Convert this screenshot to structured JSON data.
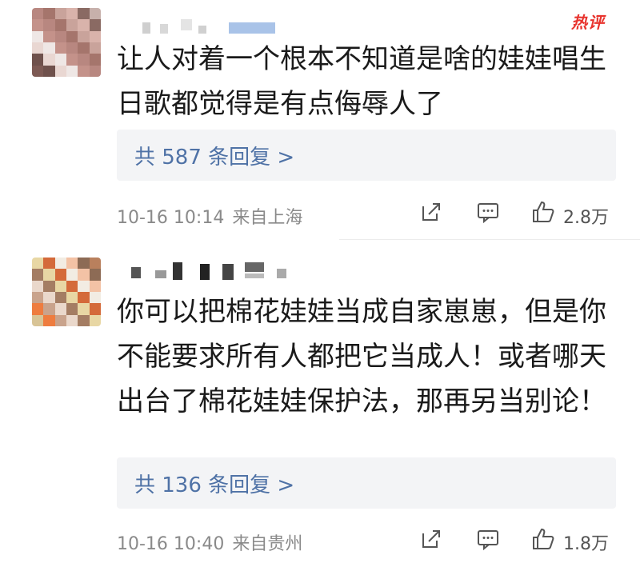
{
  "comments": [
    {
      "hot_badge": "热评",
      "text": "让人对着一个根本不知道是啥的娃娃唱生日歌都觉得是有点侮辱人了",
      "replies_label": "共 587 条回复 >",
      "date": "10-16 10:14",
      "location": "来自上海",
      "likes": "2.8万",
      "avatar_colors": [
        "#b88780",
        "#7d5a54",
        "#c9a39b",
        "#e9d7d2",
        "#8a6a63",
        "#c4928a",
        "#eee0dd",
        "#a5756c",
        "#6f514c",
        "#d9b3ab",
        "#efe7e5",
        "#c7b0ab"
      ]
    },
    {
      "hot_badge": "",
      "text": "你可以把棉花娃娃当成自家崽崽，但是你不能要求所有人都把它当成人！或者哪天出台了棉花娃娃保护法，那再另当别论！",
      "replies_label": "共 136 条回复 >",
      "date": "10-16 10:40",
      "location": "来自贵州",
      "likes": "1.8万",
      "avatar_colors": [
        "#e8d7a4",
        "#d8c496",
        "#f2ece3",
        "#c9a38c",
        "#8d6b55",
        "#a47d63",
        "#e6ddd3",
        "#d46a3a",
        "#ee7c3f",
        "#f3c2a5",
        "#ead8cb",
        "#b9805d"
      ]
    }
  ],
  "icons": {
    "forward": "share-square-icon",
    "reply": "comment-bubble-icon",
    "like": "thumbs-up-icon"
  }
}
